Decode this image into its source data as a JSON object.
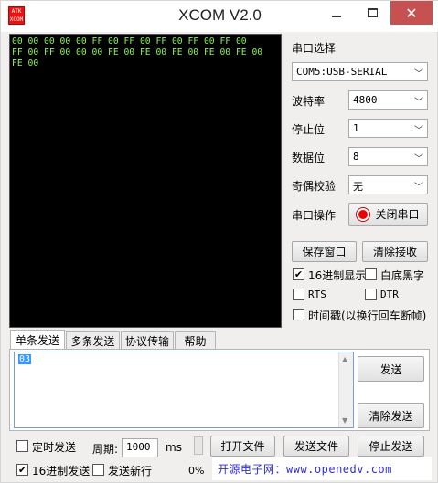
{
  "window": {
    "title": "XCOM V2.0",
    "icon_text": "ATK\nXCOM",
    "minimize": "─",
    "close": "✕"
  },
  "receive": {
    "lines": [
      "00 00 00 00 00 FF 00 FF 00 FF 00 FF 00 FF 00",
      "FF 00 FF 00 00 00 FE 00 FE 00 FE 00 FE 00 FE 00",
      "FE 00"
    ]
  },
  "settings": {
    "port_label": "串口选择",
    "port_value": "COM5:USB-SERIAL",
    "baud_label": "波特率",
    "baud_value": "4800",
    "stop_label": "停止位",
    "stop_value": "1",
    "data_label": "数据位",
    "data_value": "8",
    "parity_label": "奇偶校验",
    "parity_value": "无",
    "op_label": "串口操作",
    "op_button": "关闭串口",
    "save_window": "保存窗口",
    "clear_receive": "清除接收",
    "hex_display": "16进制显示",
    "hex_display_checked": true,
    "white_black": "白底黑字",
    "white_black_checked": false,
    "rts": "RTS",
    "rts_checked": false,
    "dtr": "DTR",
    "dtr_checked": false,
    "timestamp": "时间戳(以换行回车断帧)",
    "timestamp_checked": false
  },
  "tabs": [
    {
      "label": "单条发送",
      "active": true
    },
    {
      "label": "多条发送",
      "active": false
    },
    {
      "label": "协议传输",
      "active": false
    },
    {
      "label": "帮助",
      "active": false
    }
  ],
  "send": {
    "text": "03",
    "send_button": "发送",
    "clear_send_button": "清除发送"
  },
  "bottom": {
    "timed_send": "定时发送",
    "timed_send_checked": false,
    "period_label": "周期:",
    "period_value": "1000",
    "period_unit": "ms",
    "open_file": "打开文件",
    "send_file": "发送文件",
    "stop_send": "停止发送",
    "hex_send": "16进制发送",
    "hex_send_checked": true,
    "send_newline": "发送新行",
    "send_newline_checked": false,
    "progress": "0%",
    "url": "开源电子网：www.openedv.com"
  }
}
